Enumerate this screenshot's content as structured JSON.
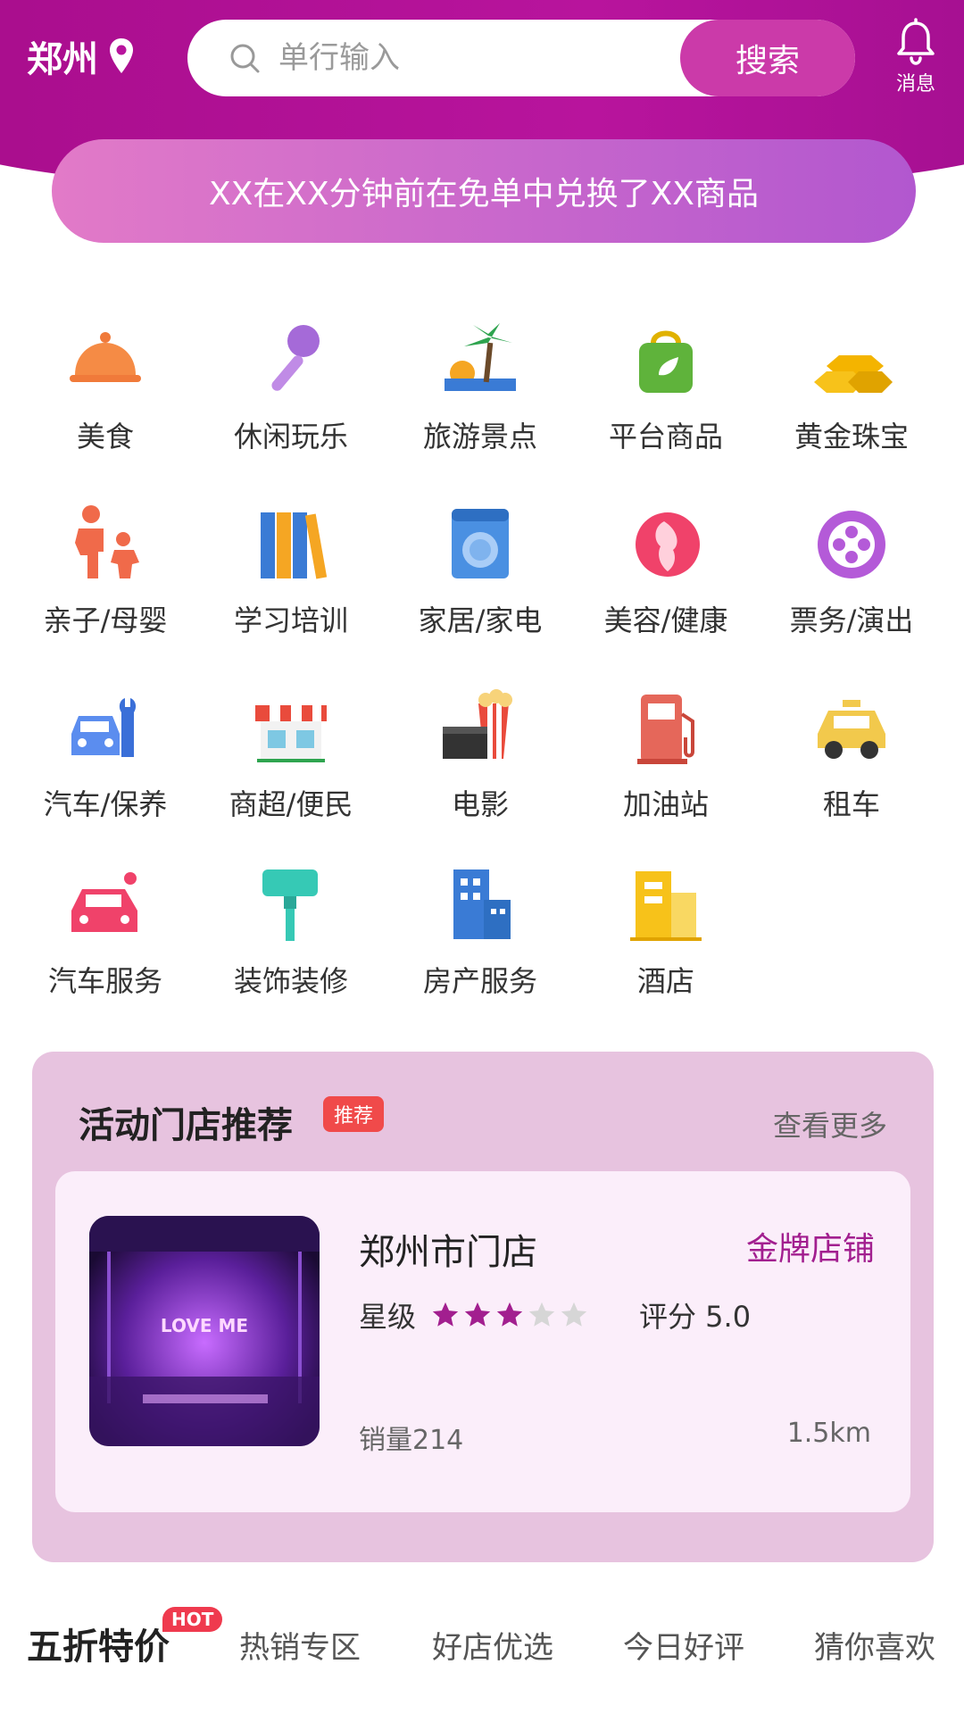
{
  "header": {
    "city": "郑州",
    "search_placeholder": "单行输入",
    "search_button": "搜索",
    "message_label": "消息"
  },
  "notice": "XX在XX分钟前在免单中兑换了XX商品",
  "categories": [
    {
      "label": "美食",
      "icon": "food-cloche-icon"
    },
    {
      "label": "休闲玩乐",
      "icon": "microphone-icon"
    },
    {
      "label": "旅游景点",
      "icon": "palm-tree-icon"
    },
    {
      "label": "平台商品",
      "icon": "shopping-bag-icon"
    },
    {
      "label": "黄金珠宝",
      "icon": "gold-bars-icon"
    },
    {
      "label": "亲子/母婴",
      "icon": "parent-child-icon"
    },
    {
      "label": "学习培训",
      "icon": "books-icon"
    },
    {
      "label": "家居/家电",
      "icon": "washing-machine-icon"
    },
    {
      "label": "美容/健康",
      "icon": "beauty-face-icon"
    },
    {
      "label": "票务/演出",
      "icon": "film-reel-icon"
    },
    {
      "label": "汽车/保养",
      "icon": "car-wrench-icon"
    },
    {
      "label": "商超/便民",
      "icon": "store-front-icon"
    },
    {
      "label": "电影",
      "icon": "cinema-popcorn-icon"
    },
    {
      "label": "加油站",
      "icon": "gas-pump-icon"
    },
    {
      "label": "租车",
      "icon": "taxi-icon"
    },
    {
      "label": "汽车服务",
      "icon": "car-service-icon"
    },
    {
      "label": "装饰装修",
      "icon": "paint-roller-icon"
    },
    {
      "label": "房产服务",
      "icon": "building-icon"
    },
    {
      "label": "酒店",
      "icon": "hotel-icon"
    }
  ],
  "activity": {
    "title": "活动门店推荐",
    "tag": "推荐",
    "more": "查看更多",
    "store": {
      "name": "郑州市门店",
      "badge": "金牌店铺",
      "star_label": "星级",
      "stars_filled": 3,
      "stars_total": 5,
      "score": "评分 5.0",
      "sales": "销量214",
      "distance": "1.5km",
      "image_text": "LOVE ME"
    }
  },
  "tabs": [
    {
      "label": "五折特价",
      "badge": "HOT"
    },
    {
      "label": "热销专区"
    },
    {
      "label": "好店优选"
    },
    {
      "label": "今日好评"
    },
    {
      "label": "猜你喜欢"
    }
  ],
  "colors": {
    "brand": "#b8149d",
    "search_button": "#cb3aa9",
    "card_bg": "#e7c3df",
    "gold_text": "#a21f8f",
    "star_filled": "#a21f8f",
    "star_empty": "#d6d6d6"
  }
}
